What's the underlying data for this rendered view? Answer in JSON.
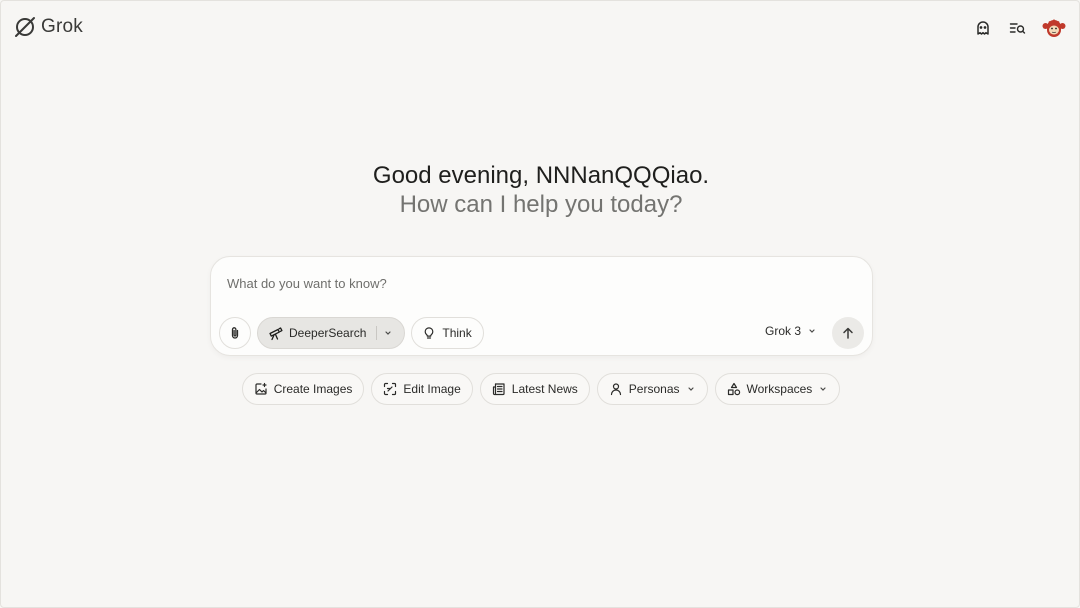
{
  "header": {
    "app_name": "Grok",
    "icons": [
      "grok-logo-icon",
      "ghost-icon",
      "history-icon",
      "avatar"
    ]
  },
  "greeting": {
    "line1": "Good evening, NNNanQQQiao.",
    "line2": "How can I help you today?"
  },
  "composer": {
    "placeholder": "What do you want to know?",
    "value": "",
    "tools": {
      "deepersearch_label": "DeeperSearch",
      "think_label": "Think"
    },
    "model_label": "Grok 3"
  },
  "quick_actions": [
    {
      "label": "Create Images",
      "icon": "image-sparkle-icon"
    },
    {
      "label": "Edit Image",
      "icon": "scan-edit-icon"
    },
    {
      "label": "Latest News",
      "icon": "newspaper-icon"
    },
    {
      "label": "Personas",
      "icon": "person-icon"
    },
    {
      "label": "Workspaces",
      "icon": "shapes-icon"
    }
  ],
  "colors": {
    "background": "#f7f6f4",
    "composer_bg": "#fdfdfc",
    "active_pill": "#e7e6e3",
    "avatar_accent": "#c0392b"
  }
}
